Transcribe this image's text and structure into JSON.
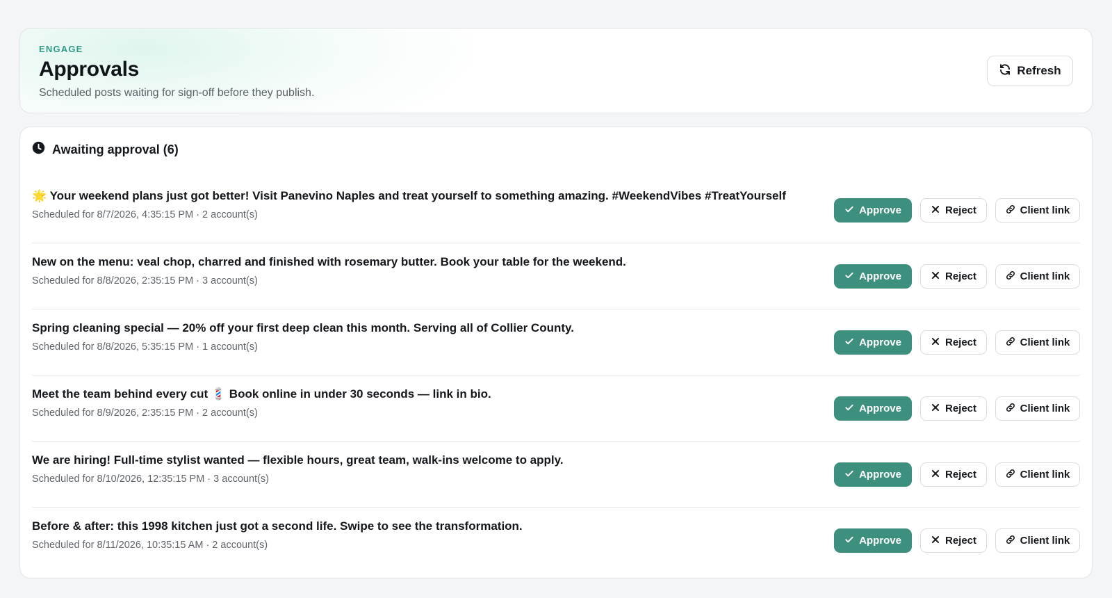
{
  "header": {
    "eyebrow": "ENGAGE",
    "title": "Approvals",
    "subtitle": "Scheduled posts waiting for sign-off before they publish.",
    "refresh_label": "Refresh"
  },
  "section": {
    "title": "Awaiting approval (6)"
  },
  "actions": {
    "approve_label": "Approve",
    "reject_label": "Reject",
    "client_link_label": "Client link"
  },
  "posts": [
    {
      "text": "🌟 Your weekend plans just got better! Visit Panevino Naples and treat yourself to something amazing. #WeekendVibes #TreatYourself",
      "meta": "Scheduled for 8/7/2026, 4:35:15 PM · 2 account(s)"
    },
    {
      "text": "New on the menu: veal chop, charred and finished with rosemary butter. Book your table for the weekend.",
      "meta": "Scheduled for 8/8/2026, 2:35:15 PM · 3 account(s)"
    },
    {
      "text": "Spring cleaning special — 20% off your first deep clean this month. Serving all of Collier County.",
      "meta": "Scheduled for 8/8/2026, 5:35:15 PM · 1 account(s)"
    },
    {
      "text": "Meet the team behind every cut 💈 Book online in under 30 seconds — link in bio.",
      "meta": "Scheduled for 8/9/2026, 2:35:15 PM · 2 account(s)"
    },
    {
      "text": "We are hiring! Full-time stylist wanted — flexible hours, great team, walk-ins welcome to apply.",
      "meta": "Scheduled for 8/10/2026, 12:35:15 PM · 3 account(s)"
    },
    {
      "text": "Before & after: this 1998 kitchen just got a second life. Swipe to see the transformation.",
      "meta": "Scheduled for 8/11/2026, 10:35:15 AM · 2 account(s)"
    }
  ],
  "colors": {
    "accent": "#3d8f7e",
    "eyebrow": "#2f9a85"
  }
}
